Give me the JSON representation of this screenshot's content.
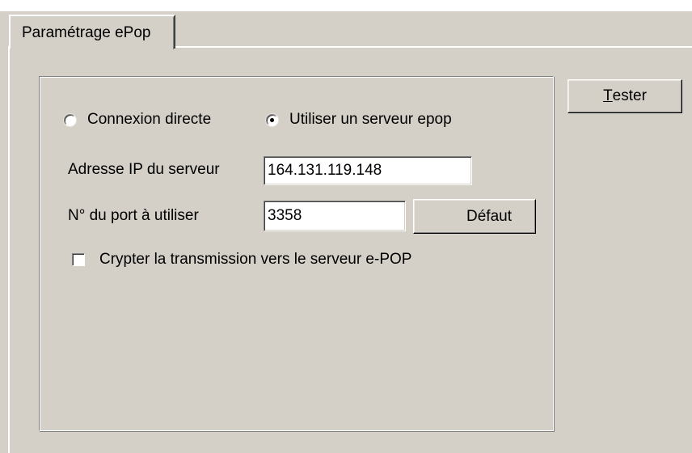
{
  "tab": {
    "label": "Paramétrage ePop"
  },
  "actions": {
    "tester_label_mnemonic": "T",
    "tester_label_rest": "ester"
  },
  "connection": {
    "options": [
      {
        "label": "Connexion directe",
        "selected": false
      },
      {
        "label": "Utiliser un serveur epop",
        "selected": true
      }
    ]
  },
  "server": {
    "ip_label": "Adresse IP du serveur",
    "ip_value": "164.131.119.148",
    "port_label": "N° du port à utiliser",
    "port_value": "3358",
    "default_button_label": "Défaut"
  },
  "encryption": {
    "label": "Crypter la transmission vers le serveur e-POP",
    "checked": false
  }
}
